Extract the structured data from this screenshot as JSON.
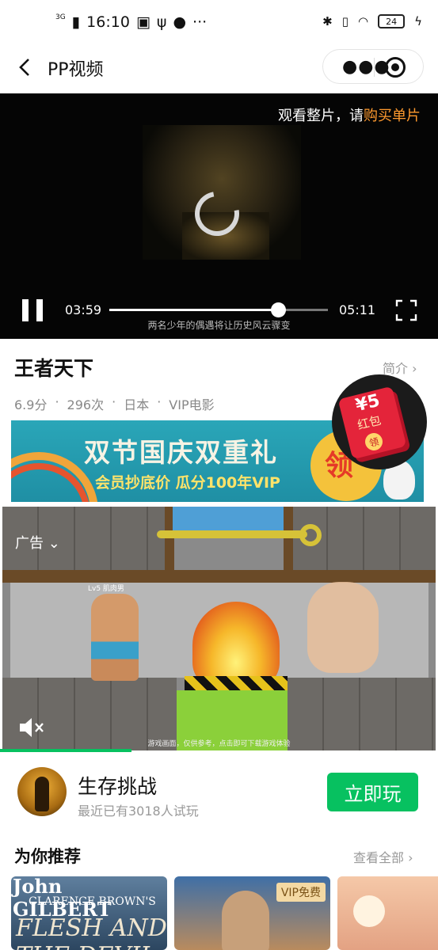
{
  "status_bar": {
    "network": "3G",
    "time": "16:10",
    "battery": "24"
  },
  "nav": {
    "title": "PP视频"
  },
  "player": {
    "buy_prefix": "观看整片，请",
    "buy_link": "购买单片",
    "current_time": "03:59",
    "duration": "05:11",
    "progress": 0.77,
    "subtitle": "两名少年的偶遇将让历史风云骤变"
  },
  "video_info": {
    "title": "王者天下",
    "intro_label": "简介",
    "rating": "6.9分",
    "plays": "296次",
    "country": "日本",
    "category": "VIP电影"
  },
  "red_packet": {
    "amount": "¥5",
    "label": "红包",
    "claim": "领"
  },
  "banner": {
    "headline": "双节国庆双重礼",
    "sub": "会员抄底价 瓜分100年VIP",
    "claim": "领"
  },
  "ad": {
    "label": "广告",
    "hero_label": "Lv5 肌肉男",
    "caption": "游戏画面，仅供参考，点击即可下载游戏体验",
    "progress": 0.3
  },
  "game": {
    "name": "生存挑战",
    "sub": "最近已有3018人试玩",
    "play_label": "立即玩"
  },
  "recommend": {
    "title": "为你推荐",
    "see_all": "查看全部",
    "cards": [
      {
        "line1": "John GILBERT",
        "line2": "CLARENCE BROWN'S",
        "line3": "FLESH AND THE DEVIL"
      },
      {
        "badge": "VIP免费"
      },
      {}
    ]
  },
  "colors": {
    "accent_green": "#07c160",
    "buy_orange": "#ff9a2e"
  }
}
